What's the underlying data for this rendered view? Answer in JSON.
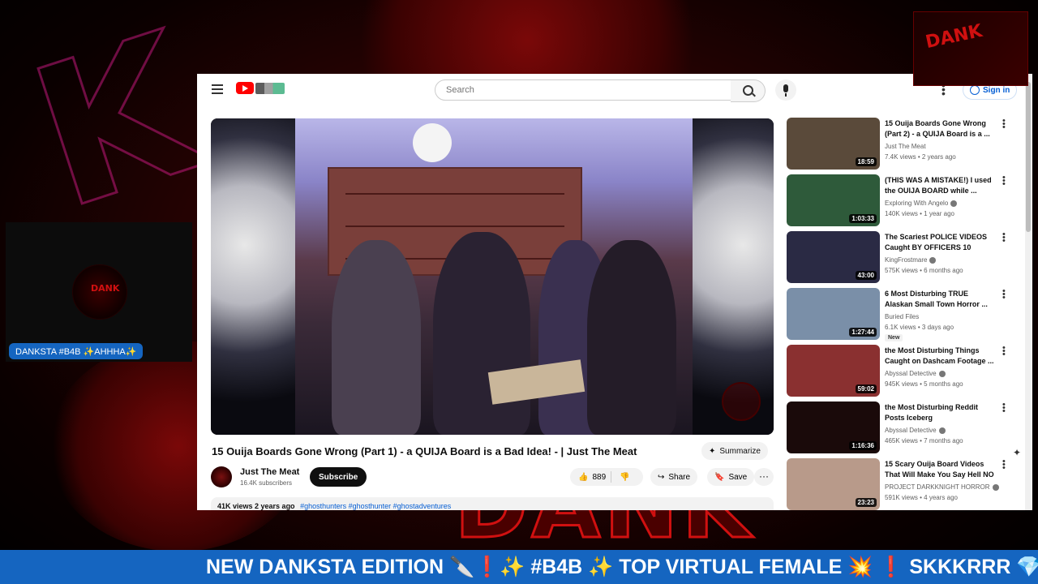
{
  "youtube": {
    "search": {
      "placeholder": "Search"
    },
    "signin_label": "Sign in",
    "video": {
      "title": "15 Ouija Boards Gone Wrong (Part 1) - a QUIJA Board is a Bad Idea! - | Just The Meat",
      "summarize_label": "Summarize",
      "channel_name": "Just The Meat",
      "channel_subs": "16.4K subscribers",
      "subscribe_label": "Subscribe",
      "likes": "889",
      "share_label": "Share",
      "save_label": "Save",
      "meta": "41K views  2 years ago",
      "tags": "#ghosthunters #ghosthunter #ghostadventures"
    },
    "recommendations": [
      {
        "title": "15 Ouija Boards Gone Wrong (Part 2) - a QUIJA Board is a ...",
        "channel": "Just The Meat",
        "views": "7.4K views • 2 years ago",
        "duration": "18:59",
        "verified": false,
        "new": "",
        "thumb_color": "#5a4a3a"
      },
      {
        "title": "(THIS WAS A MISTAKE!) I used the OUIJA BOARD while ...",
        "channel": "Exploring With Angelo",
        "views": "140K views • 1 year ago",
        "duration": "1:03:33",
        "verified": true,
        "new": "",
        "thumb_color": "#2e5a3a"
      },
      {
        "title": "The Scariest POLICE VIDEOS Caught BY OFFICERS 10",
        "channel": "KingFrostmare",
        "views": "575K views • 6 months ago",
        "duration": "43:00",
        "verified": true,
        "new": "",
        "thumb_color": "#2a2a44"
      },
      {
        "title": "6 Most Disturbing TRUE Alaskan Small Town Horror ...",
        "channel": "Buried Files",
        "views": "6.1K views • 3 days ago",
        "duration": "1:27:44",
        "verified": false,
        "new": "New",
        "thumb_color": "#7a8fa8"
      },
      {
        "title": "the Most Disturbing Things Caught on Dashcam Footage ...",
        "channel": "Abyssal Detective",
        "views": "945K views • 5 months ago",
        "duration": "59:02",
        "verified": true,
        "new": "",
        "thumb_color": "#8a3030"
      },
      {
        "title": "the Most Disturbing Reddit Posts Iceberg",
        "channel": "Abyssal Detective",
        "views": "465K views • 7 months ago",
        "duration": "1:16:36",
        "verified": true,
        "new": "",
        "thumb_color": "#1a0a0a"
      },
      {
        "title": "15 Scary Ouija Board Videos That Will Make You Say Hell NO",
        "channel": "PROJECT DARKKNIGHT HORROR",
        "views": "591K views • 4 years ago",
        "duration": "23:23",
        "verified": true,
        "new": "",
        "thumb_color": "#b89a8a"
      }
    ]
  },
  "overlay": {
    "cam_label": "DANKSTA #B4B ✨AHHHA✨",
    "ticker": "NEW DANKSTA EDITION 🔪❗✨ #B4B ✨ TOP VIRTUAL FEMALE 💥 ❗ SKKKRRR 💎"
  }
}
